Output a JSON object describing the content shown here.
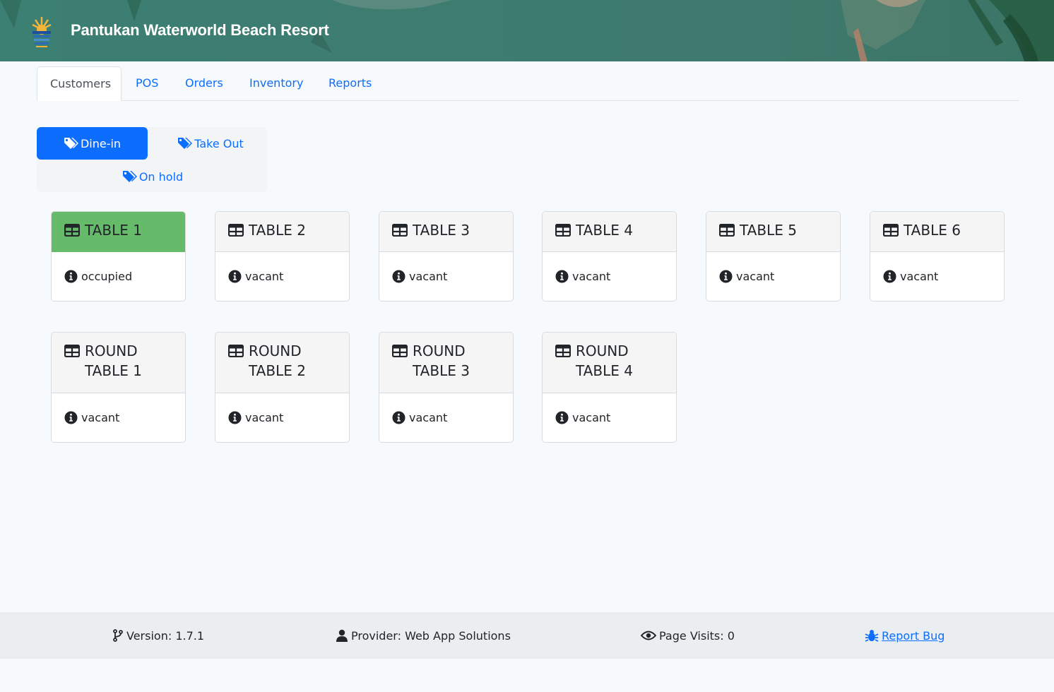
{
  "header": {
    "title": "Pantukan Waterworld Beach Resort"
  },
  "tabs": [
    {
      "label": "Customers",
      "active": true
    },
    {
      "label": "POS"
    },
    {
      "label": "Orders"
    },
    {
      "label": "Inventory"
    },
    {
      "label": "Reports"
    }
  ],
  "order_types": [
    {
      "label": "Dine-in",
      "active": true,
      "icon": "tags-icon"
    },
    {
      "label": "Take Out",
      "icon": "tags-icon"
    },
    {
      "label": "On hold",
      "icon": "tags-icon"
    }
  ],
  "tables": [
    {
      "line1": "TABLE 1",
      "line2": "",
      "status": "occupied"
    },
    {
      "line1": "TABLE 2",
      "line2": "",
      "status": "vacant"
    },
    {
      "line1": "TABLE 3",
      "line2": "",
      "status": "vacant"
    },
    {
      "line1": "TABLE 4",
      "line2": "",
      "status": "vacant"
    },
    {
      "line1": "TABLE 5",
      "line2": "",
      "status": "vacant"
    },
    {
      "line1": "TABLE 6",
      "line2": "",
      "status": "vacant"
    },
    {
      "line1": "ROUND",
      "line2": "TABLE 1",
      "status": "vacant"
    },
    {
      "line1": "ROUND",
      "line2": "TABLE 2",
      "status": "vacant"
    },
    {
      "line1": "ROUND",
      "line2": "TABLE 3",
      "status": "vacant"
    },
    {
      "line1": "ROUND",
      "line2": "TABLE 4",
      "status": "vacant"
    }
  ],
  "footer": {
    "version": "Version: 1.7.1",
    "provider": "Provider: Web App Solutions",
    "visits": "Page Visits: 0",
    "report_bug": "Report Bug"
  },
  "colors": {
    "header_bg": "#3e7c70",
    "primary": "#0d6efd",
    "occupied": "#66bb6a"
  }
}
